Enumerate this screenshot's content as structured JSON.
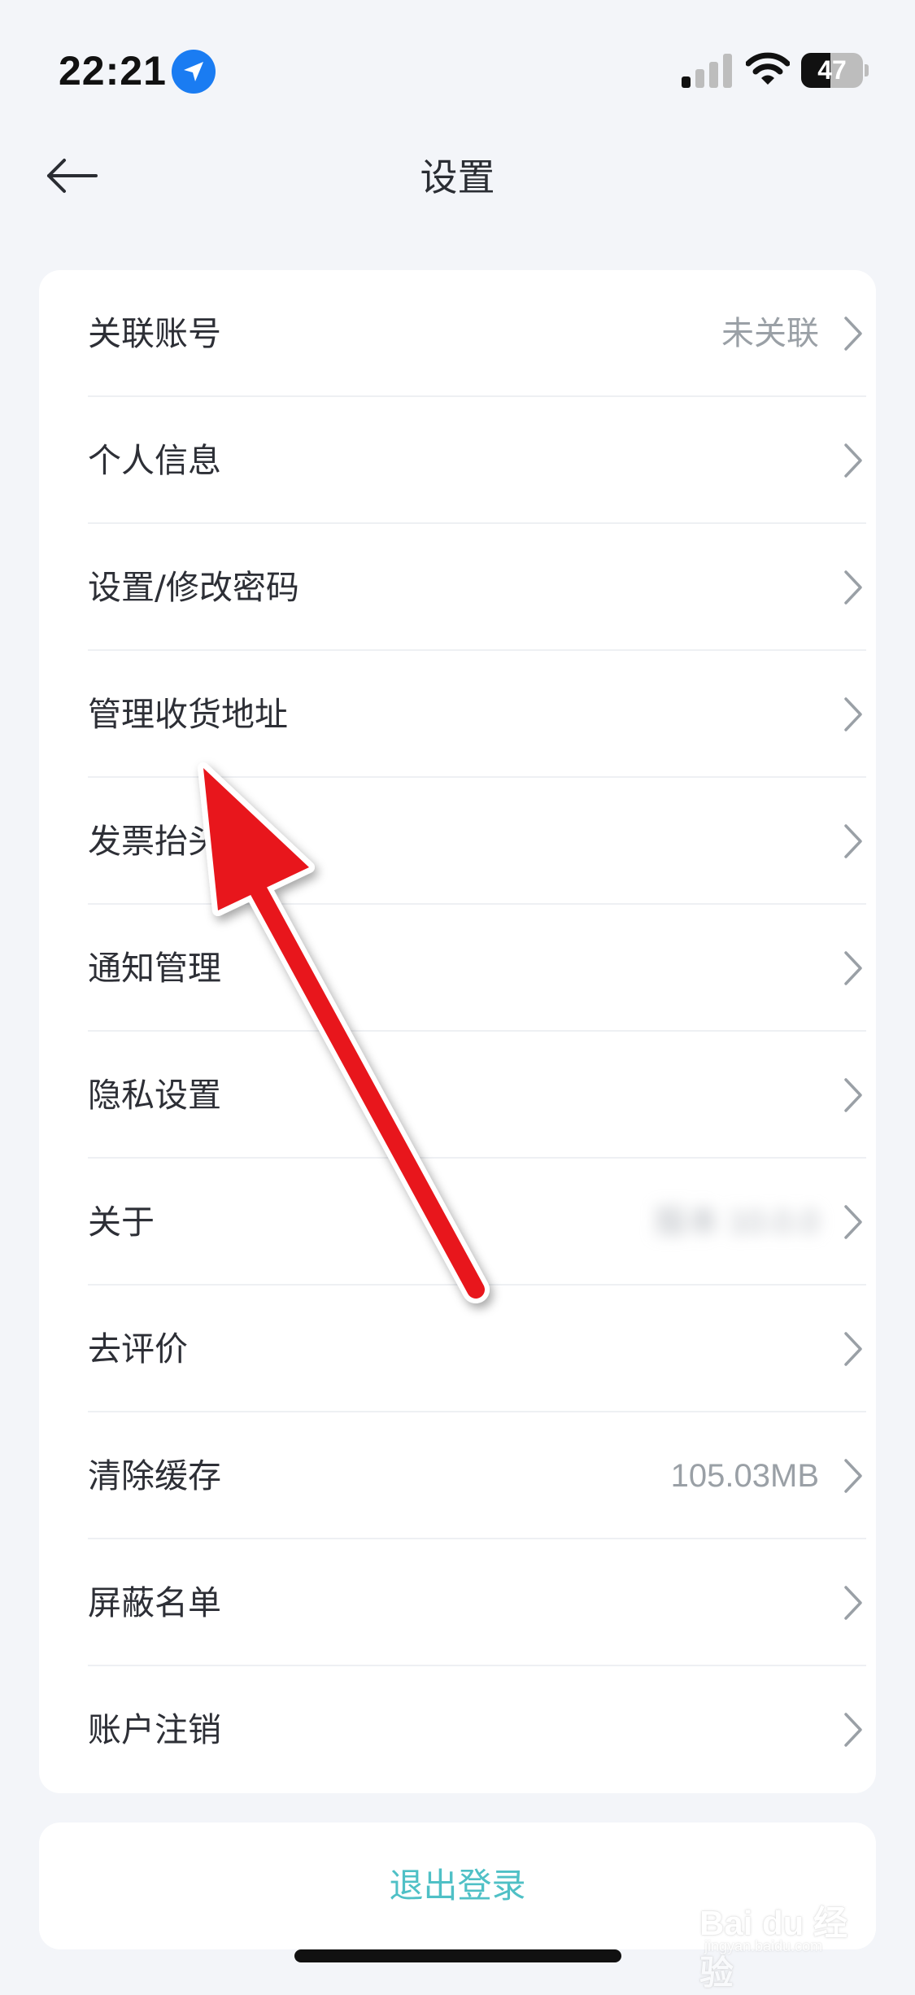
{
  "status_bar": {
    "time": "22:21",
    "battery": "47",
    "battery_level": 0.47
  },
  "header": {
    "title": "设置"
  },
  "settings": [
    {
      "label": "关联账号",
      "value": "未关联",
      "blurred": false
    },
    {
      "label": "个人信息",
      "value": "",
      "blurred": false
    },
    {
      "label": "设置/修改密码",
      "value": "",
      "blurred": false
    },
    {
      "label": "管理收货地址",
      "value": "",
      "blurred": false
    },
    {
      "label": "发票抬头",
      "value": "",
      "blurred": false
    },
    {
      "label": "通知管理",
      "value": "",
      "blurred": false
    },
    {
      "label": "隐私设置",
      "value": "",
      "blurred": false
    },
    {
      "label": "关于",
      "value": "版本 10.0.0",
      "blurred": true
    },
    {
      "label": "去评价",
      "value": "",
      "blurred": false
    },
    {
      "label": "清除缓存",
      "value": "105.03MB",
      "blurred": false
    },
    {
      "label": "屏蔽名单",
      "value": "",
      "blurred": false
    },
    {
      "label": "账户注销",
      "value": "",
      "blurred": false
    }
  ],
  "logout": {
    "label": "退出登录"
  },
  "watermark": {
    "main": "Bai du 经验",
    "sub": "jingyan.baidu.com"
  },
  "colors": {
    "background": "#f3f5f9",
    "accent": "#4fc0c6",
    "annotation": "#e8141c"
  }
}
